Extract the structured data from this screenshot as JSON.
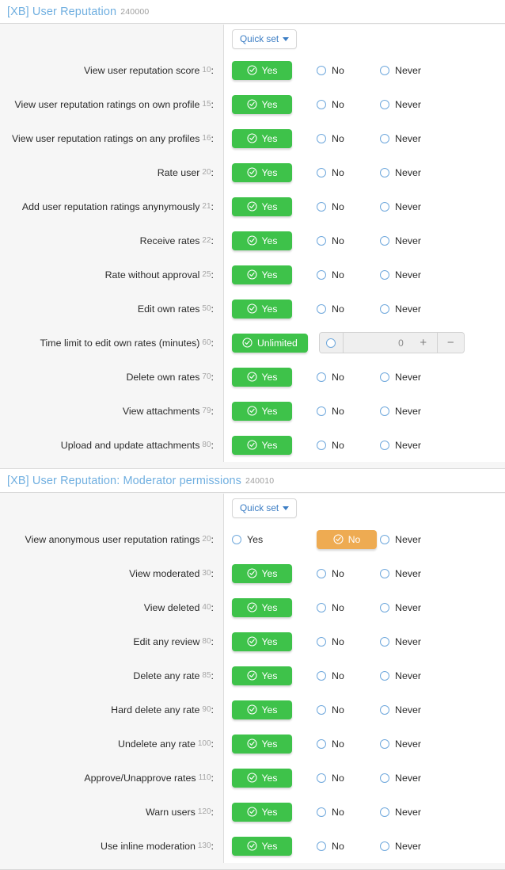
{
  "colors": {
    "yes_green": "#3ec24a",
    "no_orange": "#eeab52",
    "link_blue": "#70afe0",
    "radio_blue": "#6fa8dc",
    "label_gray": "#a5a5a5",
    "panel_gray": "#f6f6f6"
  },
  "quick_set": {
    "label": "Quick set",
    "caret": "chevron-down-icon"
  },
  "options": {
    "yes": "Yes",
    "no": "No",
    "never": "Never",
    "unlimited": "Unlimited"
  },
  "stepper": {
    "value": "0",
    "plus": "+",
    "minus": "−"
  },
  "sections": [
    {
      "title": "[XB] User Reputation",
      "id": "240000",
      "rows": [
        {
          "label": "View user reputation score",
          "num": "10",
          "type": "tri",
          "selected": "yes"
        },
        {
          "label": "View user reputation ratings on own profile",
          "num": "15",
          "type": "tri",
          "selected": "yes"
        },
        {
          "label": "View user reputation ratings on any profiles",
          "num": "16",
          "type": "tri",
          "selected": "yes"
        },
        {
          "label": "Rate user",
          "num": "20",
          "type": "tri",
          "selected": "yes"
        },
        {
          "label": "Add user reputation ratings anynymously",
          "num": "21",
          "type": "tri",
          "selected": "yes"
        },
        {
          "label": "Receive rates",
          "num": "22",
          "type": "tri",
          "selected": "yes"
        },
        {
          "label": "Rate without approval",
          "num": "25",
          "type": "tri",
          "selected": "yes"
        },
        {
          "label": "Edit own rates",
          "num": "50",
          "type": "tri",
          "selected": "yes"
        },
        {
          "label": "Time limit to edit own rates (minutes)",
          "num": "60",
          "type": "unlimited",
          "selected": "unlimited"
        },
        {
          "label": "Delete own rates",
          "num": "70",
          "type": "tri",
          "selected": "yes"
        },
        {
          "label": "View attachments",
          "num": "79",
          "type": "tri",
          "selected": "yes"
        },
        {
          "label": "Upload and update attachments",
          "num": "80",
          "type": "tri",
          "selected": "yes"
        }
      ]
    },
    {
      "title": "[XB] User Reputation: Moderator permissions",
      "id": "240010",
      "rows": [
        {
          "label": "View anonymous user reputation ratings",
          "num": "20",
          "type": "tri",
          "selected": "no"
        },
        {
          "label": "View moderated",
          "num": "30",
          "type": "tri",
          "selected": "yes"
        },
        {
          "label": "View deleted",
          "num": "40",
          "type": "tri",
          "selected": "yes"
        },
        {
          "label": "Edit any review",
          "num": "80",
          "type": "tri",
          "selected": "yes"
        },
        {
          "label": "Delete any rate",
          "num": "85",
          "type": "tri",
          "selected": "yes"
        },
        {
          "label": "Hard delete any rate",
          "num": "90",
          "type": "tri",
          "selected": "yes"
        },
        {
          "label": "Undelete any rate",
          "num": "100",
          "type": "tri",
          "selected": "yes"
        },
        {
          "label": "Approve/Unapprove rates",
          "num": "110",
          "type": "tri",
          "selected": "yes"
        },
        {
          "label": "Warn users",
          "num": "120",
          "type": "tri",
          "selected": "yes"
        },
        {
          "label": "Use inline moderation",
          "num": "130",
          "type": "tri",
          "selected": "yes"
        }
      ]
    }
  ]
}
